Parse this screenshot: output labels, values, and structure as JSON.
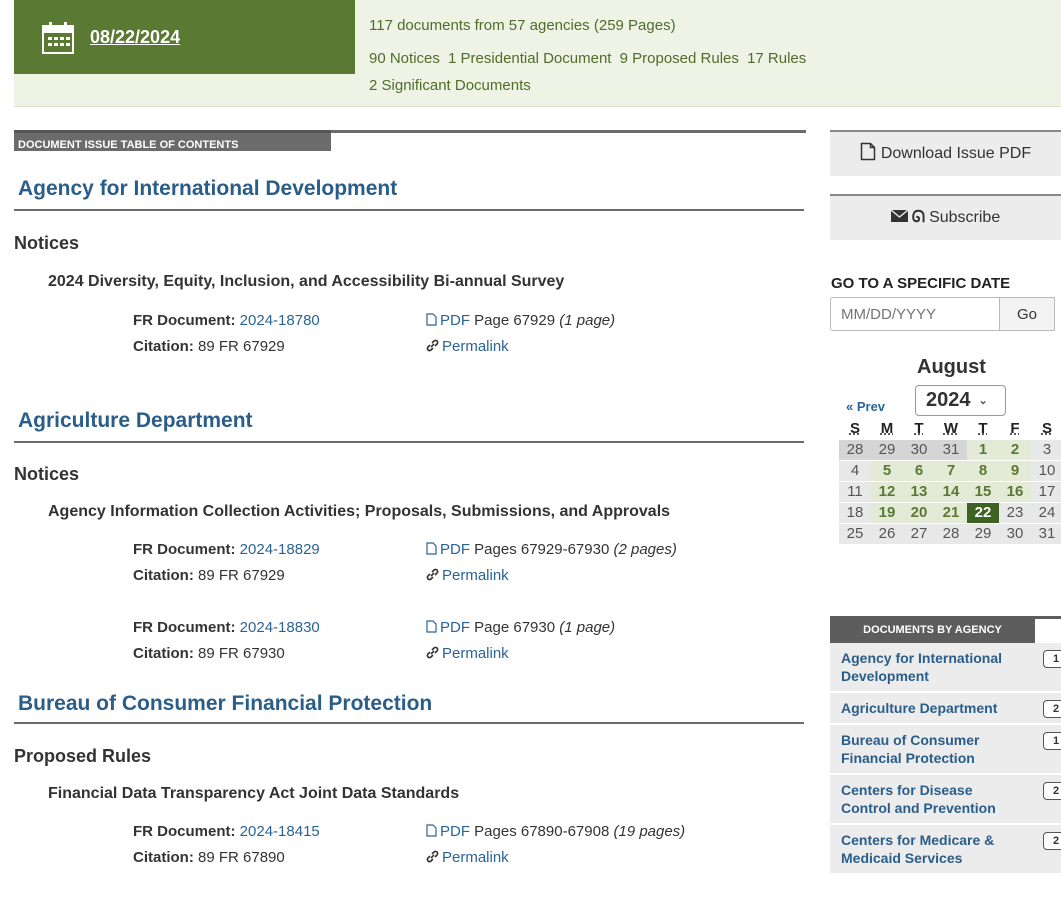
{
  "header": {
    "date": "08/22/2024",
    "summary_line1": "117 documents from 57 agencies (259 Pages)",
    "counts": [
      "90 Notices",
      "1 Presidential Document",
      "9 Proposed Rules",
      "17 Rules"
    ],
    "significant": "2 Significant Documents"
  },
  "toc": {
    "tab_label": "DOCUMENT ISSUE TABLE OF CONTENTS",
    "agencies": [
      {
        "name": "Agency for International Development",
        "type": "Notices",
        "title": "2024 Diversity, Equity, Inclusion, and Accessibility Bi-annual Survey",
        "docs": [
          {
            "fr_label": "FR Document:",
            "fr": "2024-18780",
            "cit_label": "Citation:",
            "cit": "89 FR 67929",
            "pdf": "PDF",
            "pages": "Page 67929",
            "pagecount": "(1 page)",
            "permalink": "Permalink"
          }
        ]
      },
      {
        "name": "Agriculture Department",
        "type": "Notices",
        "title": "Agency Information Collection Activities; Proposals, Submissions, and Approvals",
        "docs": [
          {
            "fr_label": "FR Document:",
            "fr": "2024-18829",
            "cit_label": "Citation:",
            "cit": "89 FR 67929",
            "pdf": "PDF",
            "pages": "Pages 67929-67930",
            "pagecount": "(2 pages)",
            "permalink": "Permalink"
          },
          {
            "fr_label": "FR Document:",
            "fr": "2024-18830",
            "cit_label": "Citation:",
            "cit": "89 FR 67930",
            "pdf": "PDF",
            "pages": "Page 67930",
            "pagecount": "(1 page)",
            "permalink": "Permalink"
          }
        ]
      },
      {
        "name": "Bureau of Consumer Financial Protection",
        "type": "Proposed Rules",
        "title": "Financial Data Transparency Act Joint Data Standards",
        "docs": [
          {
            "fr_label": "FR Document:",
            "fr": "2024-18415",
            "cit_label": "Citation:",
            "cit": "89 FR 67890",
            "pdf": "PDF",
            "pages": "Pages 67890-67908",
            "pagecount": "(19 pages)",
            "permalink": "Permalink"
          }
        ]
      }
    ]
  },
  "sidebar": {
    "download": "Download Issue PDF",
    "subscribe": "Subscribe",
    "go_heading": "GO TO A SPECIFIC DATE",
    "date_placeholder": "MM/DD/YYYY",
    "go_button": "Go",
    "month": "August",
    "prev": "« Prev",
    "year": "2024",
    "weekdays": [
      "S",
      "M",
      "T",
      "W",
      "T",
      "F",
      "S"
    ],
    "weeks": [
      [
        "28",
        "29",
        "30",
        "31",
        "1",
        "2",
        "3"
      ],
      [
        "4",
        "5",
        "6",
        "7",
        "8",
        "9",
        "10"
      ],
      [
        "11",
        "12",
        "13",
        "14",
        "15",
        "16",
        "17"
      ],
      [
        "18",
        "19",
        "20",
        "21",
        "22",
        "23",
        "24"
      ],
      [
        "25",
        "26",
        "27",
        "28",
        "29",
        "30",
        "31"
      ]
    ],
    "by_agency_label": "DOCUMENTS BY AGENCY",
    "agencies": [
      {
        "name": "Agency for International Development",
        "count": "1"
      },
      {
        "name": "Agriculture Department",
        "count": "2"
      },
      {
        "name": "Bureau of Consumer Financial Protection",
        "count": "1"
      },
      {
        "name": "Centers for Disease Control and Prevention",
        "count": "2"
      },
      {
        "name": "Centers for Medicare & Medicaid Services",
        "count": "2"
      }
    ]
  },
  "colors": {
    "header_green": "#5a7932",
    "selected_day": "#3d6221",
    "link_blue": "#2a5d89"
  }
}
